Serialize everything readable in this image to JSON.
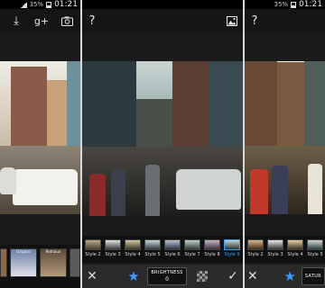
{
  "panel1": {
    "status": {
      "battery_pct": "35%",
      "time": "01:21"
    },
    "actions": [
      {
        "name": "download-icon",
        "glyph": "⤓"
      },
      {
        "name": "google-plus-icon",
        "glyph": "g+"
      },
      {
        "name": "camera-settings-icon",
        "glyph": "⚙"
      }
    ],
    "tile_labels": [
      "Original",
      "Retrolux"
    ]
  },
  "panel2": {
    "help": "?",
    "styles": [
      "Style 2",
      "Style 3",
      "Style 4",
      "Style 5",
      "Style 6",
      "Style 7",
      "Style 8",
      "Style 9"
    ],
    "selected_style": "Style 9",
    "adjust": {
      "label": "BRIGHTNESS",
      "value": "0"
    }
  },
  "panel3": {
    "status": {
      "battery_pct": "35%",
      "time": "01:21"
    },
    "help": "?",
    "styles": [
      "Style 2",
      "Style 3",
      "Style 4",
      "Style 5",
      "Style 6"
    ],
    "adjust": {
      "label": "SATUR"
    }
  },
  "colors": {
    "accent": "#3aa0ff"
  }
}
